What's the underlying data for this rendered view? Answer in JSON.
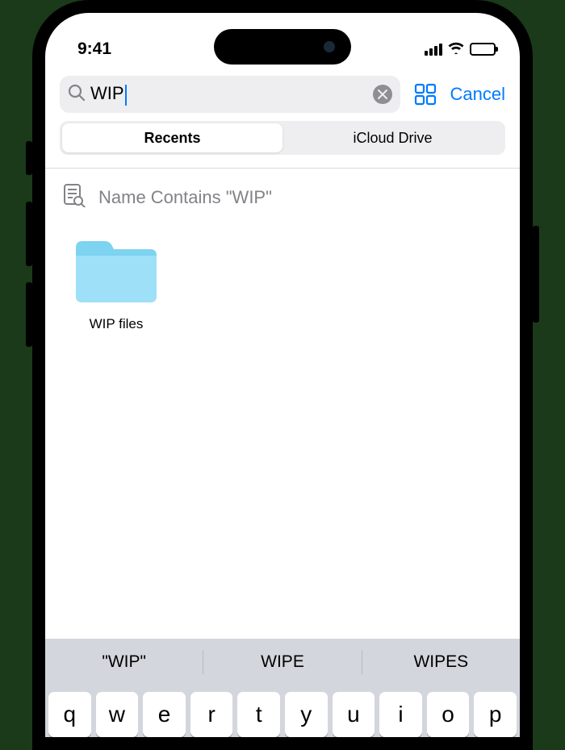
{
  "status": {
    "time": "9:41"
  },
  "search": {
    "value": "WIP",
    "cancel": "Cancel"
  },
  "tabs": {
    "recents": "Recents",
    "icloud": "iCloud Drive"
  },
  "suggestion": {
    "prefix": "Name Contains ",
    "term": "\"WIP\""
  },
  "results": [
    {
      "name": "WIP files"
    }
  ],
  "predictive": [
    "\"WIP\"",
    "WIPE",
    "WIPES"
  ],
  "keyboard_row1": [
    "q",
    "w",
    "e",
    "r",
    "t",
    "y",
    "u",
    "i",
    "o",
    "p"
  ]
}
